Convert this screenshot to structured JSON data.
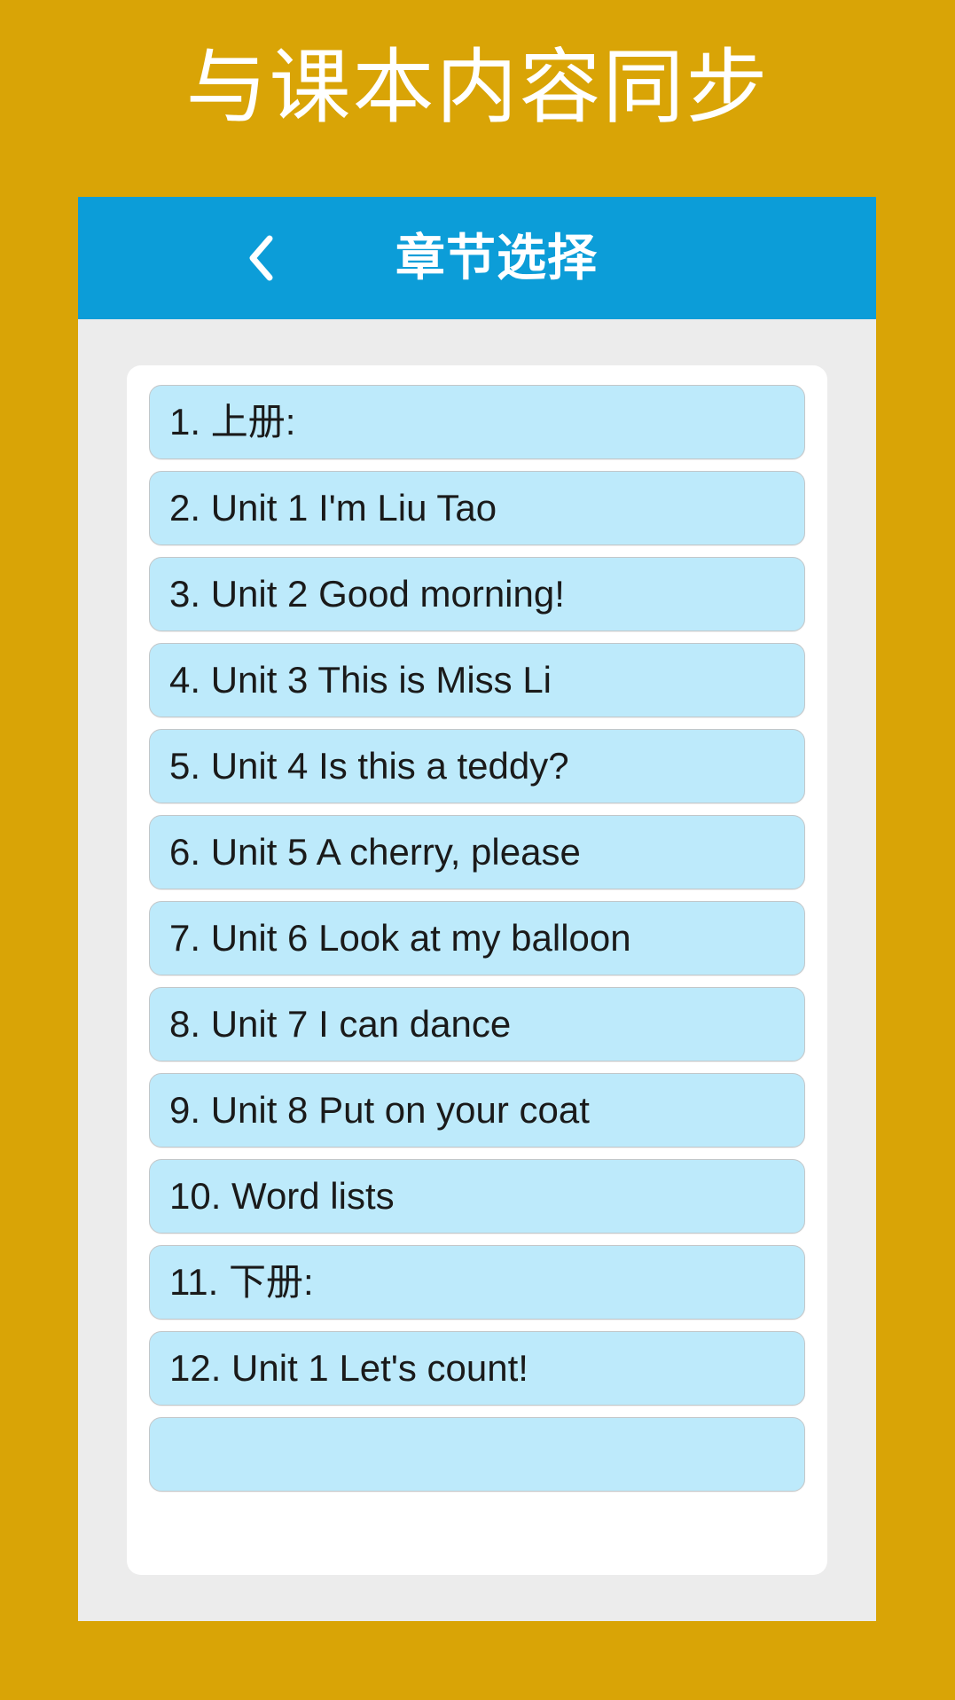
{
  "promo": {
    "headline": "与课本内容同步"
  },
  "colors": {
    "page_background": "#d9a406",
    "app_bar": "#0c9dd8",
    "item_background": "#bdeafb",
    "card_background": "#ffffff",
    "screen_background": "#ececec",
    "item_text": "#1a1a1a",
    "headline_text": "#ffffff"
  },
  "app_bar": {
    "back_icon": "chevron-left-icon",
    "title": "章节选择"
  },
  "chapter_list": {
    "items": [
      {
        "label": "1. 上册:"
      },
      {
        "label": "2. Unit 1 I'm Liu Tao"
      },
      {
        "label": "3. Unit 2 Good morning!"
      },
      {
        "label": "4. Unit 3 This is Miss Li"
      },
      {
        "label": "5. Unit 4 Is this a teddy?"
      },
      {
        "label": "6. Unit 5 A cherry, please"
      },
      {
        "label": "7. Unit 6 Look at my balloon"
      },
      {
        "label": "8. Unit 7 I can dance"
      },
      {
        "label": "9. Unit 8 Put on your coat"
      },
      {
        "label": "10. Word lists"
      },
      {
        "label": "11. 下册:"
      },
      {
        "label": "12. Unit 1 Let's count!"
      },
      {
        "label": ""
      }
    ]
  }
}
